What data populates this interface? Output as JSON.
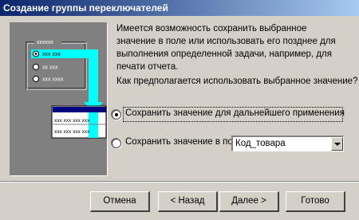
{
  "window": {
    "title": "Создание группы переключателей"
  },
  "illustration": {
    "header_mark": "xxxxxx",
    "options": [
      "xxx xxx",
      "xx xxx",
      "xxx xxxx"
    ],
    "table_rows": [
      "xxx xxx xxx xxx",
      "xxx xxx xxx xxx"
    ],
    "colors": {
      "arrow": "#00ffff",
      "table_header": "#000080",
      "highlight_column": "#00ffff"
    }
  },
  "description": "Имеется возможность сохранить выбранное значение в поле или использовать его позднее для выполнения определенной задачи, например, для печати отчета.",
  "question": "Как предполагается использовать выбранное значение?",
  "options": {
    "save_for_later": {
      "label": "Сохранить значение для дальнейшего применения",
      "selected": true
    },
    "save_in_field": {
      "label": "Сохранить значение в поле:",
      "selected": false
    }
  },
  "field_select": {
    "value": "Код_товара"
  },
  "buttons": {
    "cancel": "Отмена",
    "back": "< Назад",
    "next": "Далее >",
    "finish": "Готово"
  }
}
